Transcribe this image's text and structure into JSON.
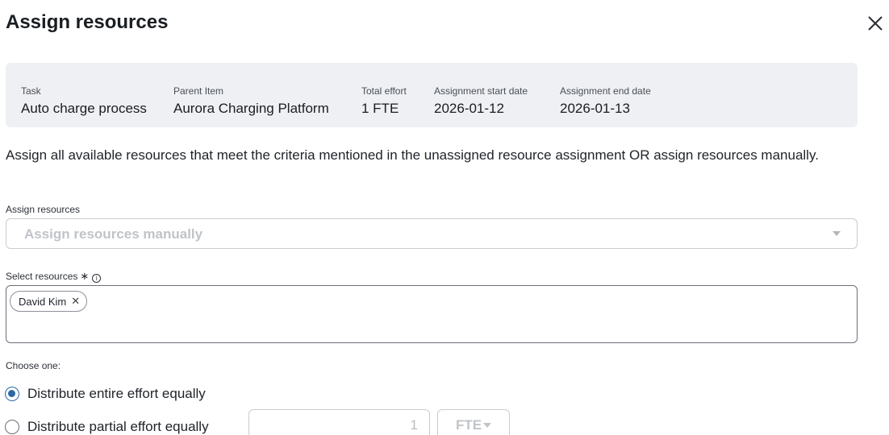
{
  "dialog": {
    "title": "Assign resources",
    "close_icon": "close-icon"
  },
  "info": {
    "task_label": "Task",
    "task_value": "Auto charge process",
    "parent_label": "Parent Item",
    "parent_value": "Aurora Charging Platform",
    "effort_label": "Total effort",
    "effort_value": "1 FTE",
    "start_label": "Assignment start date",
    "start_value": "2026-01-12",
    "end_label": "Assignment end date",
    "end_value": "2026-01-13"
  },
  "description": "Assign all available resources that meet the criteria mentioned in the unassigned resource assignment OR assign resources manually.",
  "assign_resources": {
    "label": "Assign resources",
    "selected_value": "Assign resources manually"
  },
  "select_resources": {
    "label": "Select resources",
    "required_mark": "∗",
    "info_glyph": "i",
    "chips": [
      {
        "label": "David Kim",
        "remove_glyph": "✕"
      }
    ]
  },
  "distribution": {
    "label": "Choose one:",
    "options": [
      {
        "label": "Distribute entire effort equally",
        "checked": true
      },
      {
        "label": "Distribute partial effort equally",
        "checked": false
      }
    ],
    "partial_value": "1",
    "unit_value": "FTE"
  },
  "colors": {
    "accent": "#2c6aa3",
    "panel_bg": "#eef0f3",
    "disabled_text": "#c0c3c8"
  }
}
